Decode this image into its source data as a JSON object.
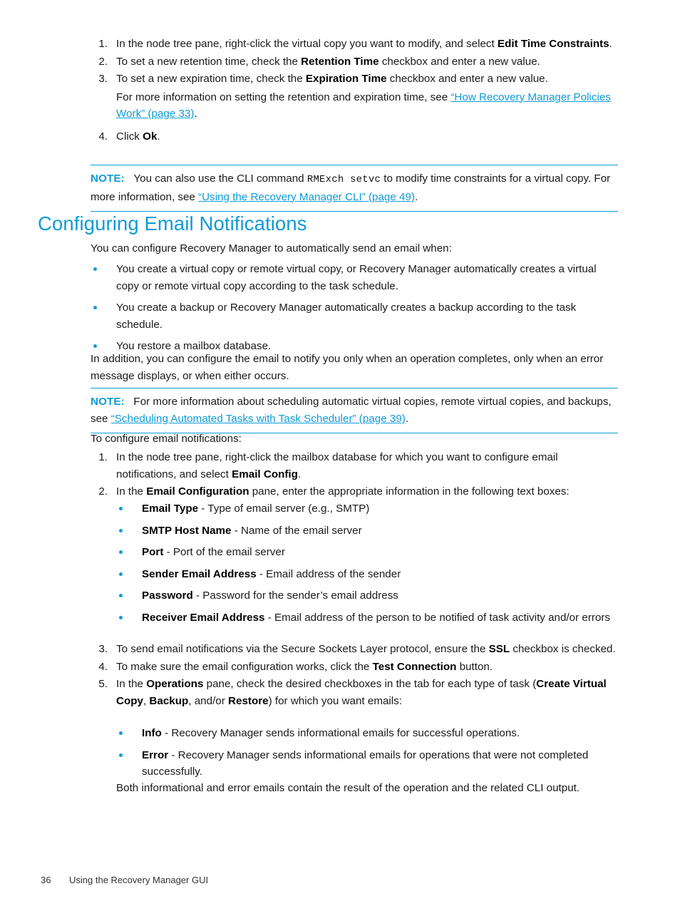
{
  "document": {
    "heading": "Configuring Email Notifications",
    "footer": {
      "page_number": "36",
      "chapter": "Using the Recovery Manager GUI"
    },
    "colors": {
      "accent_blue": "#0e9bd8",
      "body_text": "#1a1a1a"
    }
  },
  "steps_time_constraints": {
    "items": [
      {
        "num": "1.",
        "pre": "In the node tree pane, right-click the virtual copy you want to modify, and select ",
        "bold": "Edit Time Constraints",
        "post": "."
      },
      {
        "num": "2.",
        "pre": "To set a new retention time, check the ",
        "bold": "Retention Time",
        "post": " checkbox and enter a new value."
      },
      {
        "num": "3.",
        "pre": "To set a new expiration time, check the ",
        "bold": "Expiration Time",
        "post": " checkbox and enter a new value."
      },
      {
        "num": "4.",
        "pre": "Click ",
        "bold": "Ok",
        "post": "."
      }
    ],
    "continuation": {
      "pre": "For more information on setting the retention and expiration time, see ",
      "link": "“How Recovery Manager Policies Work” (page 33)",
      "post": "."
    }
  },
  "note_cli": {
    "label": "NOTE:",
    "pre": "You can also use the CLI command ",
    "mono": "RMExch setvc",
    "mid": " to modify time constraints for a virtual copy. For more information, see ",
    "link": "“Using the Recovery Manager CLI” (page 49)",
    "post": "."
  },
  "intro": {
    "lead": "You can configure Recovery Manager to automatically send an email when:",
    "bullets": [
      "You create a virtual copy or remote virtual copy, or Recovery Manager automatically creates a virtual copy or remote virtual copy according to the task schedule.",
      "You create a backup or Recovery Manager automatically creates a backup according to the task schedule.",
      "You restore a mailbox database."
    ],
    "closing": "In addition, you can configure the email to notify you only when an operation completes, only when an error message displays, or when either occurs."
  },
  "note_scheduling": {
    "label": "NOTE:",
    "pre": "For more information about scheduling automatic virtual copies, remote virtual copies, and backups, see ",
    "link": "“Scheduling Automated Tasks with Task Scheduler” (page 39)",
    "post": "."
  },
  "procedure": {
    "lead": "To configure email notifications:",
    "step1": {
      "num": "1.",
      "pre": "In the node tree pane, right-click the mailbox database for which you want to configure email notifications, and select ",
      "bold": "Email Config",
      "post": "."
    },
    "step2": {
      "num": "2.",
      "pre": "In the ",
      "bold": "Email Configuration",
      "post": " pane, enter the appropriate information in the following text boxes:"
    },
    "fields": [
      {
        "term": "Email Type",
        "desc": " - Type of email server (e.g., SMTP)"
      },
      {
        "term": "SMTP Host Name",
        "desc": " - Name of the email server"
      },
      {
        "term": "Port",
        "desc": " - Port of the email server"
      },
      {
        "term": "Sender Email Address",
        "desc": " - Email address of the sender"
      },
      {
        "term": "Password",
        "desc": " - Password for the sender’s email address"
      },
      {
        "term": "Receiver Email Address",
        "desc": " - Email address of the person to be notified of task activity and/or errors"
      }
    ],
    "step3": {
      "num": "3.",
      "pre": "To send email notifications via the Secure Sockets Layer protocol, ensure the ",
      "bold": "SSL",
      "post": " checkbox is checked."
    },
    "step4": {
      "num": "4.",
      "pre": "To make sure the email configuration works, click the ",
      "bold": "Test Connection",
      "post": " button."
    },
    "step5": {
      "num": "5.",
      "p1": "In the ",
      "b1": "Operations",
      "p2": " pane, check the desired checkboxes in the tab for each type of task (",
      "b2": "Create Virtual Copy",
      "p3": ", ",
      "b3": "Backup",
      "p4": ", and/or ",
      "b4": "Restore",
      "p5": ") for which you want emails:"
    },
    "email_types": [
      {
        "term": "Info",
        "desc": " - Recovery Manager sends informational emails for successful operations."
      },
      {
        "term": "Error",
        "desc": " - Recovery Manager sends informational emails for operations that were not completed successfully."
      }
    ],
    "closing": "Both informational and error emails contain the result of the operation and the related CLI output."
  }
}
